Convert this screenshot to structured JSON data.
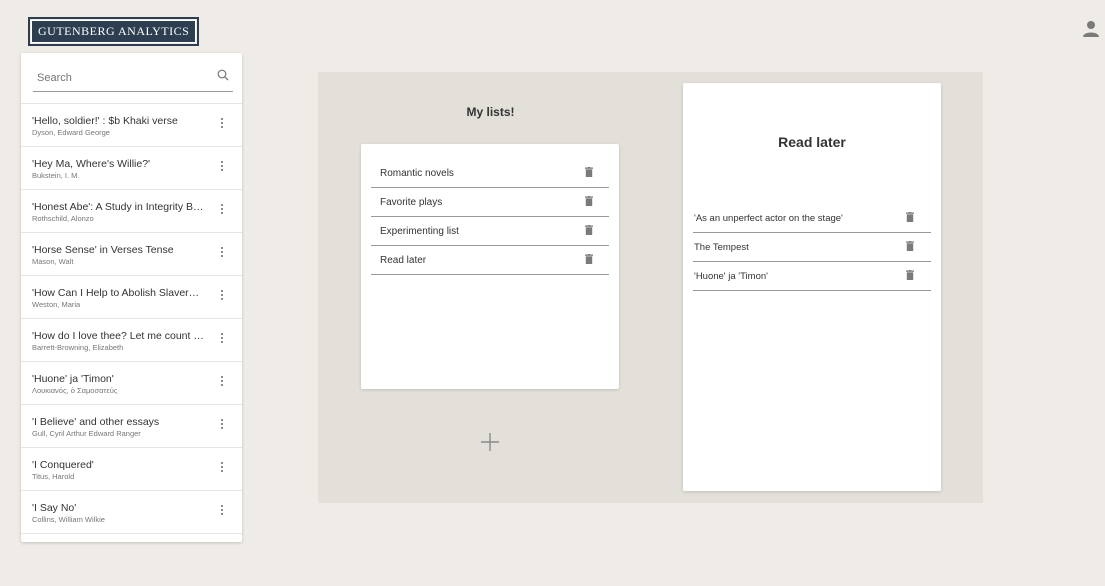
{
  "header": {
    "logo_text": "GUTENBERG ANALYTICS",
    "user_icon": "user-icon"
  },
  "sidebar": {
    "search": {
      "placeholder": "Search",
      "value": ""
    },
    "books": [
      {
        "title": "'Hello, soldier!' : $b Khaki verse",
        "author": "Dyson, Edward George"
      },
      {
        "title": "'Hey Ma, Where's Willie?'",
        "author": "Bukstein, I. M."
      },
      {
        "title": "'Honest Abe': A Study in Integrity Based on the Early Life of Abraham Lincoln",
        "author": "Rothschild, Alonzo"
      },
      {
        "title": "'Horse Sense' in Verses Tense",
        "author": "Mason, Walt"
      },
      {
        "title": "'How Can I Help to Abolish Slavery?' or, Counsels to the Newly Converted",
        "author": "Weston, Maria"
      },
      {
        "title": "'How do I love thee? Let me count the ways'",
        "author": "Barrett-Browning, Elizabeth"
      },
      {
        "title": "'Huone' ja 'Timon'",
        "author": "Λουκιανός, ὁ Σαμοσατεύς"
      },
      {
        "title": "'I Believe' and other essays",
        "author": "Gull, Cyril Arthur Edward Ranger"
      },
      {
        "title": "'I Conquered'",
        "author": "Titus, Harold"
      },
      {
        "title": "'I Say No'",
        "author": "Collins, William Wilkie"
      }
    ]
  },
  "my_lists": {
    "title": "My lists!",
    "lists": [
      {
        "name": "Romantic novels"
      },
      {
        "name": "Favorite plays"
      },
      {
        "name": "Experimenting list"
      },
      {
        "name": "Read later"
      }
    ],
    "add_icon": "plus-icon"
  },
  "selected_list": {
    "title": "Read later",
    "items": [
      {
        "name": "'As an unperfect actor on the stage'"
      },
      {
        "name": "The Tempest"
      },
      {
        "name": "'Huone' ja 'Timon'"
      }
    ]
  },
  "colors": {
    "background": "#efece7",
    "workspace": "#e2e0d9",
    "logo": "#2c3e50",
    "icon": "#666666"
  }
}
